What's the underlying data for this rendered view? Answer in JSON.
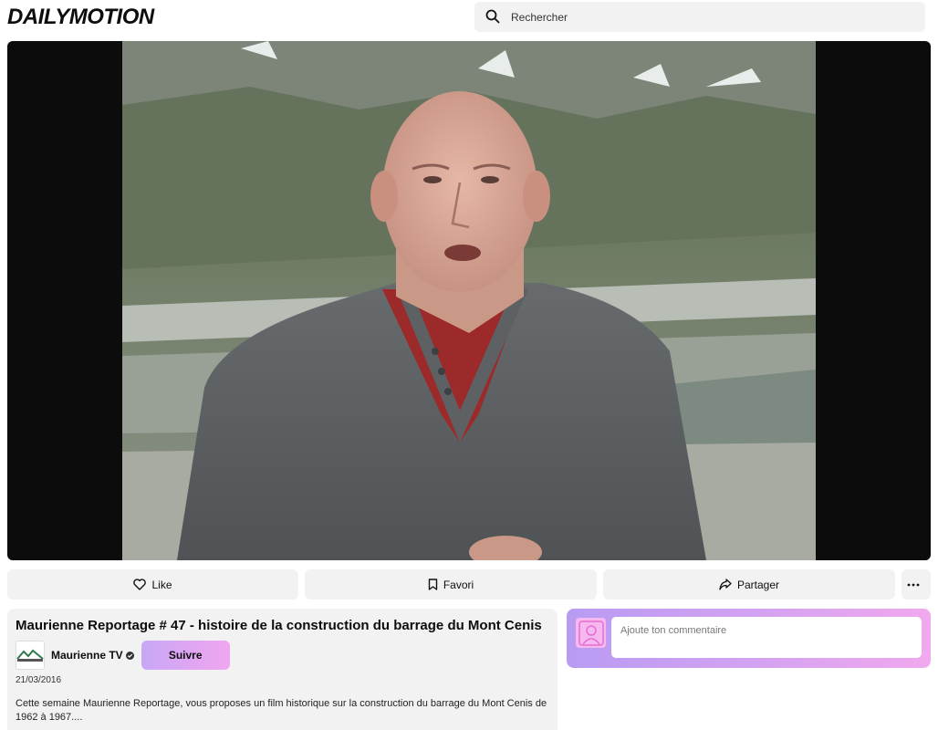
{
  "header": {
    "logo": "DAILYMOTION",
    "search_placeholder": "Rechercher"
  },
  "actions": {
    "like": "Like",
    "favorite": "Favori",
    "share": "Partager"
  },
  "video": {
    "title": "Maurienne Reportage # 47 - histoire de la construction du barrage du Mont Cenis",
    "channel_name": "Maurienne TV",
    "follow_label": "Suivre",
    "date": "21/03/2016",
    "description": "Cette semaine Maurienne Reportage, vous proposes un film historique sur la construction du barrage du Mont Cenis de 1962 à 1967...."
  },
  "comment": {
    "placeholder": "Ajoute ton commentaire"
  },
  "colors": {
    "accent_start": "#c8a7f5",
    "accent_end": "#f0a6f0",
    "surface": "#f2f2f2"
  }
}
